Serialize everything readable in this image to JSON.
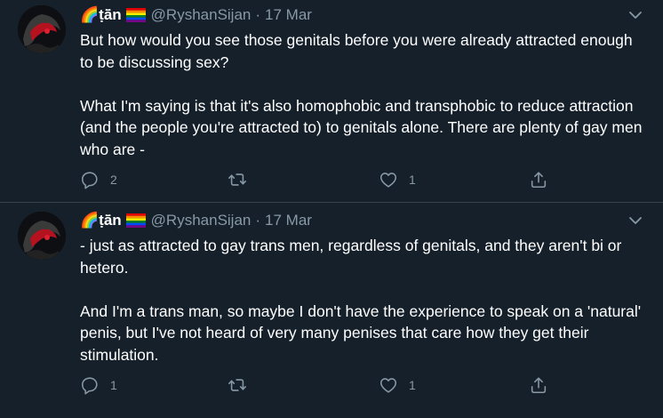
{
  "colors": {
    "background": "#15202b",
    "text": "#ffffff",
    "secondary": "#8899a6",
    "divider": "#38444d"
  },
  "tweets": [
    {
      "display_name": "🌈ṭā̈n",
      "handle": "@RyshanSijan",
      "separator": "·",
      "time": "17 Mar",
      "paragraphs": [
        "But how would you see those genitals before you were already attracted enough to be discussing sex?",
        "What I'm saying is that it's also homophobic and transphobic to reduce attraction (and the people you're attracted to) to genitals alone.  There are plenty of gay men who are -"
      ],
      "reply_count": "2",
      "retweet_count": "",
      "like_count": "1",
      "icons": [
        "reply-icon",
        "retweet-icon",
        "like-icon",
        "share-icon"
      ]
    },
    {
      "display_name": "🌈ṭā̈n",
      "handle": "@RyshanSijan",
      "separator": "·",
      "time": "17 Mar",
      "paragraphs": [
        "- just as attracted to gay trans men, regardless of genitals, and they aren't bi or hetero.",
        "And I'm a trans man, so maybe I don't have the experience to speak on a 'natural' penis, but I've not heard of very many penises that care how they get their stimulation."
      ],
      "reply_count": "1",
      "retweet_count": "",
      "like_count": "1",
      "icons": [
        "reply-icon",
        "retweet-icon",
        "like-icon",
        "share-icon"
      ]
    }
  ]
}
